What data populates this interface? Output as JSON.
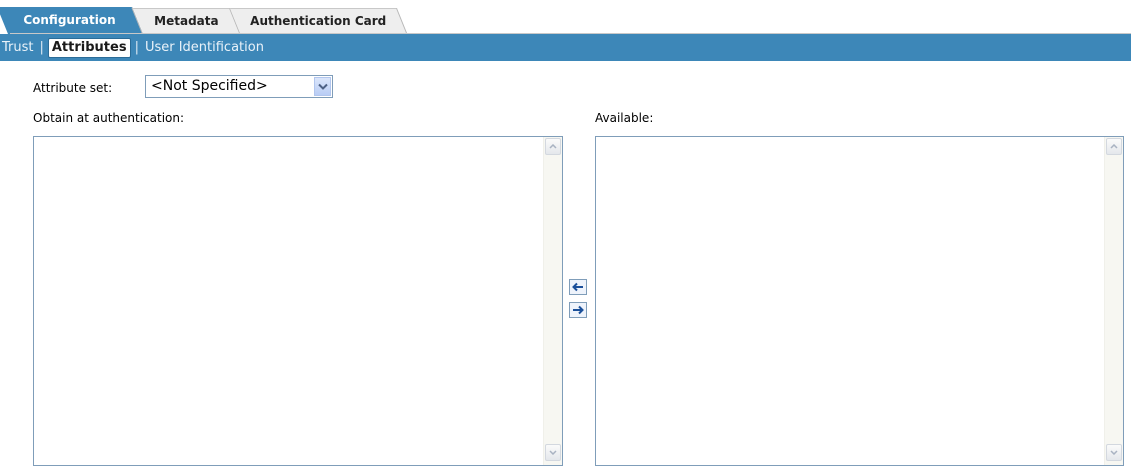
{
  "tabs": [
    {
      "label": "Configuration",
      "active": true
    },
    {
      "label": "Metadata",
      "active": false
    },
    {
      "label": "Authentication Card",
      "active": false
    }
  ],
  "subnav": {
    "items": [
      {
        "label": "Trust",
        "active": false
      },
      {
        "label": "Attributes",
        "active": true
      },
      {
        "label": "User Identification",
        "active": false
      }
    ],
    "separator": "|"
  },
  "attribute_set": {
    "label": "Attribute set:",
    "selected": "<Not Specified>"
  },
  "obtain": {
    "label": "Obtain at authentication:"
  },
  "available": {
    "label": "Available:"
  },
  "colors": {
    "accent": "#3d87b8"
  },
  "icons": {
    "dropdown": "chevron-down-icon",
    "move_left": "arrow-left-icon",
    "move_right": "arrow-right-icon"
  }
}
